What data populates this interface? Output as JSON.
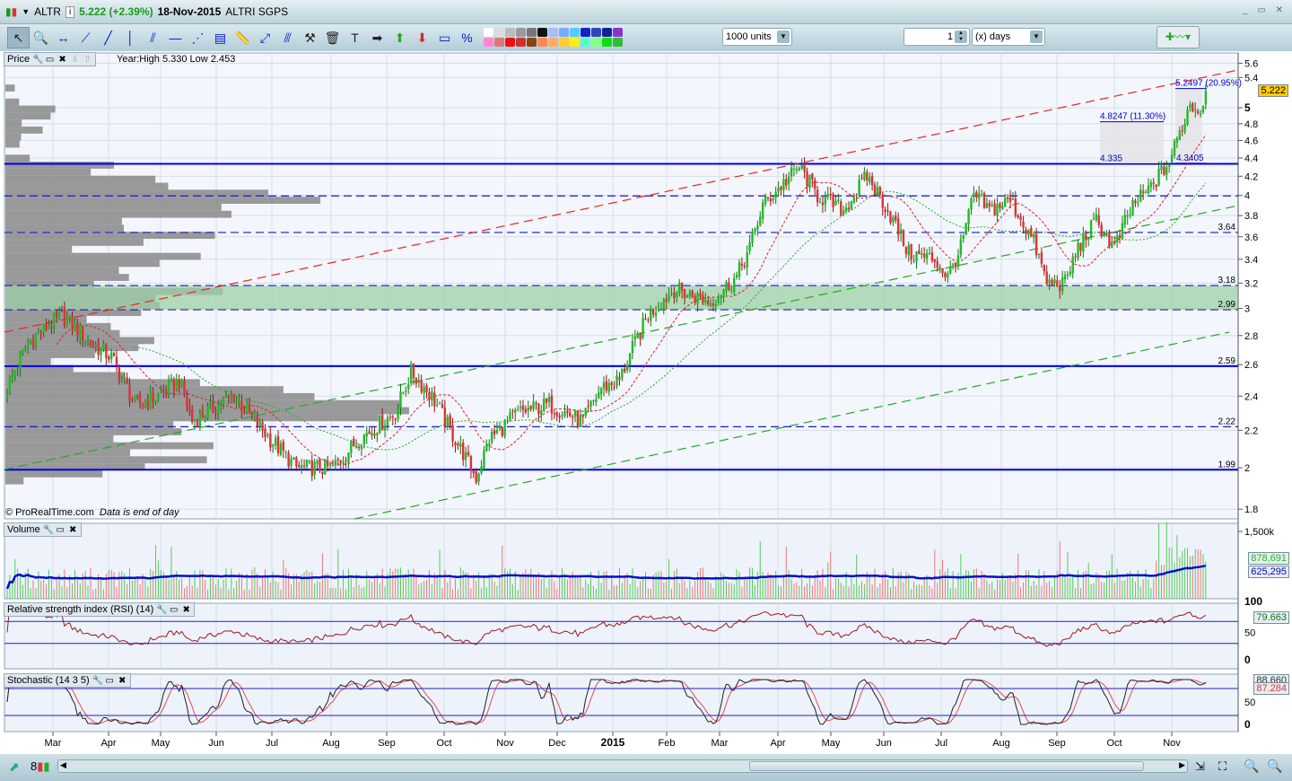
{
  "titlebar": {
    "symbol": "ALTR",
    "price_change": "5.222 (+2.39%)",
    "date": "18-Nov-2015",
    "name": "ALTRI SGPS",
    "info": "i"
  },
  "toolbar": {
    "units": "1000 units",
    "period_value": "1",
    "period_unit": "(x) days",
    "tools": [
      "pointer-icon",
      "zoom-icon",
      "horizontal-measure-icon",
      "segment-icon",
      "line-icon",
      "vertical-line-icon",
      "channel-icon",
      "horizontal-line-icon",
      "fan-icon",
      "indicator-icon",
      "ruler-icon",
      "arrow-segment-icon",
      "parallel-icon",
      "tools-icon",
      "trash-icon",
      "text-icon",
      "right-arrow-icon",
      "up-arrow-icon",
      "down-arrow-icon",
      "rectangle-icon",
      "percent-icon"
    ],
    "swatches": [
      "#ffffff",
      "#dddddd",
      "#bbbbbb",
      "#999999",
      "#777777",
      "#111111",
      "#aabbff",
      "#77aaff",
      "#55ccff",
      "#1122cc",
      "#3344bb",
      "#112299",
      "#8833cc",
      "#ff88cc",
      "#dd7777",
      "#ee1111",
      "#cc3333",
      "#884411",
      "#ff8855",
      "#ffaa66",
      "#ffcc33",
      "#ffee11",
      "#55ffcc",
      "#88ff88",
      "#11dd11",
      "#33bb33",
      "#118811"
    ]
  },
  "price_panel": {
    "label": "Price",
    "info": "Year:High 5.330 Low 2.453",
    "copyright": "© ProRealTime.com",
    "note": "Data is end of day",
    "last": "5.222",
    "annotations": {
      "box1_top": "4.8247 (11.30%)",
      "box1_bottom": "4.335",
      "box2_top": "5.2497 (20.95%)",
      "box2_bottom": "4.3405"
    },
    "levels": [
      {
        "label": "3.64",
        "v": 3.64
      },
      {
        "label": "3.18",
        "v": 3.18
      },
      {
        "label": "2.99",
        "v": 2.99
      },
      {
        "label": "2.59",
        "v": 2.59
      },
      {
        "label": "2.22",
        "v": 2.22
      },
      {
        "label": "1.99",
        "v": 1.99
      }
    ]
  },
  "volume_panel": {
    "label": "Volume",
    "value": "878,691",
    "avg": "625,295",
    "axis": [
      "1,500k"
    ]
  },
  "rsi_panel": {
    "label": "Relative strength index (RSI) (14)",
    "value": "79.663",
    "axis": [
      "100",
      "50",
      "0"
    ]
  },
  "stoch_panel": {
    "label": "Stochastic (14 3 5)",
    "value1": "88.660",
    "value2": "87.284",
    "axis": [
      "50",
      "0"
    ]
  },
  "xaxis": [
    "Mar",
    "Apr",
    "May",
    "Jun",
    "Jul",
    "Aug",
    "Sep",
    "Oct",
    "Nov",
    "Dec",
    "2015",
    "Feb",
    "Mar",
    "Apr",
    "May",
    "Jun",
    "Jul",
    "Aug",
    "Sep",
    "Oct",
    "Nov"
  ],
  "colors": {
    "up": "#22bb22",
    "down": "#dd3333",
    "level": "#0000dd",
    "zone": "#9fd0a6",
    "trend_red": "#ee2222",
    "trend_green": "#22aa22"
  },
  "chart_data": {
    "type": "candlestick",
    "scale": "log",
    "ylim": [
      1.75,
      5.7
    ],
    "yticks": [
      1.8,
      2,
      2.2,
      2.4,
      2.6,
      2.8,
      3,
      3.2,
      3.4,
      3.6,
      3.8,
      4,
      4.2,
      4.4,
      4.6,
      4.8,
      5,
      5.4,
      5.6
    ],
    "close_anchors": [
      [
        0,
        2.45
      ],
      [
        8,
        2.75
      ],
      [
        21,
        2.95
      ],
      [
        32,
        2.75
      ],
      [
        40,
        2.65
      ],
      [
        49,
        2.35
      ],
      [
        58,
        2.4
      ],
      [
        66,
        2.5
      ],
      [
        71,
        2.25
      ],
      [
        87,
        2.4
      ],
      [
        101,
        2.15
      ],
      [
        111,
        2.0
      ],
      [
        125,
        2.0
      ],
      [
        135,
        2.15
      ],
      [
        149,
        2.3
      ],
      [
        155,
        2.55
      ],
      [
        163,
        2.4
      ],
      [
        170,
        2.2
      ],
      [
        180,
        1.95
      ],
      [
        185,
        2.15
      ],
      [
        196,
        2.3
      ],
      [
        208,
        2.35
      ],
      [
        221,
        2.25
      ],
      [
        228,
        2.45
      ],
      [
        235,
        2.5
      ],
      [
        246,
        2.95
      ],
      [
        256,
        3.15
      ],
      [
        270,
        3.05
      ],
      [
        280,
        3.25
      ],
      [
        285,
        3.5
      ],
      [
        290,
        3.9
      ],
      [
        304,
        4.3
      ],
      [
        311,
        4.0
      ],
      [
        321,
        3.85
      ],
      [
        330,
        4.2
      ],
      [
        337,
        3.9
      ],
      [
        346,
        3.45
      ],
      [
        356,
        3.4
      ],
      [
        361,
        3.25
      ],
      [
        366,
        3.5
      ],
      [
        371,
        4.0
      ],
      [
        377,
        3.85
      ],
      [
        385,
        3.95
      ],
      [
        394,
        3.55
      ],
      [
        399,
        3.2
      ],
      [
        406,
        3.2
      ],
      [
        411,
        3.5
      ],
      [
        418,
        3.75
      ],
      [
        425,
        3.5
      ],
      [
        432,
        3.9
      ],
      [
        438,
        4.05
      ],
      [
        446,
        4.35
      ],
      [
        449,
        4.6
      ],
      [
        454,
        5.05
      ],
      [
        458,
        4.95
      ],
      [
        460,
        5.222
      ]
    ]
  }
}
